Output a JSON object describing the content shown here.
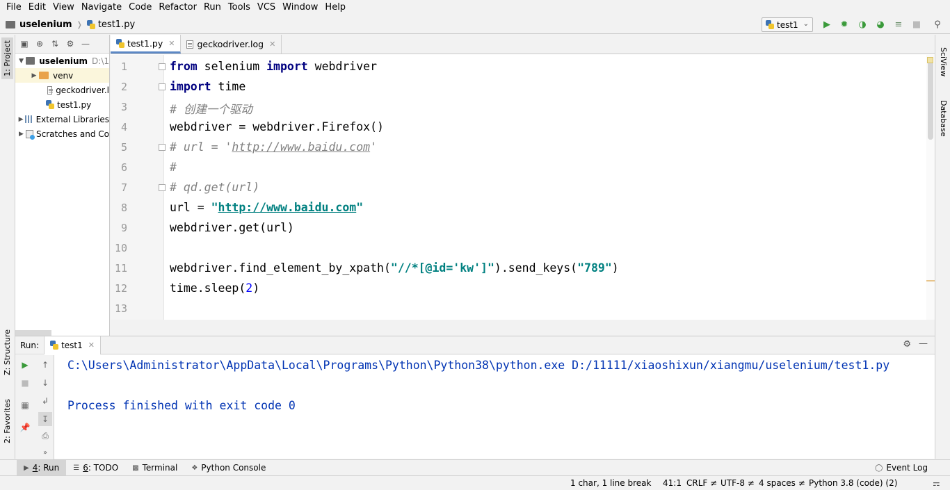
{
  "menu": [
    "File",
    "Edit",
    "View",
    "Navigate",
    "Code",
    "Refactor",
    "Run",
    "Tools",
    "VCS",
    "Window",
    "Help"
  ],
  "breadcrumb": {
    "project": "uselenium",
    "file": "test1.py"
  },
  "run_config": {
    "name": "test1"
  },
  "left_tabs": {
    "project": "1: Project",
    "structure": "Z: Structure",
    "favorites": "2: Favorites"
  },
  "right_tabs": {
    "sciview": "SciView",
    "database": "Database"
  },
  "project_tree": {
    "root": "uselenium",
    "root_path": "D:\\1",
    "items": [
      "venv",
      "geckodriver.l",
      "test1.py"
    ],
    "external": "External Libraries",
    "scratches": "Scratches and Co"
  },
  "editor_tabs": [
    {
      "label": "test1.py"
    },
    {
      "label": "geckodriver.log"
    }
  ],
  "line_numbers": [
    "1",
    "2",
    "3",
    "4",
    "5",
    "6",
    "7",
    "8",
    "9",
    "10",
    "11",
    "12",
    "13"
  ],
  "code": {
    "l1": {
      "kw1": "from",
      "t1": " selenium ",
      "kw2": "import",
      "t2": " webdriver"
    },
    "l2": {
      "kw": "import",
      "t": " time"
    },
    "l3": "# 创建一个驱动",
    "l4": "webdriver = webdriver.Firefox()",
    "l5": {
      "c1": "# url = '",
      "link": "http://www.baidu.com",
      "c2": "'"
    },
    "l6": "#",
    "l7": "# qd.get(url)",
    "l8": {
      "t": "url = ",
      "q1": "\"",
      "link": "http://www.baidu.com",
      "q2": "\""
    },
    "l9": "webdriver.get(url)",
    "l11": {
      "t1": "webdriver.find_element_by_xpath(",
      "s1": "\"//*[@id='kw']\"",
      "t2": ").send_keys(",
      "s2": "\"789\"",
      "t3": ")"
    },
    "l12": {
      "t1": "time.sleep(",
      "n": "2",
      "t2": ")"
    }
  },
  "run": {
    "label": "Run:",
    "tab": "test1",
    "output": [
      "C:\\Users\\Administrator\\AppData\\Local\\Programs\\Python\\Python38\\python.exe D:/11111/xiaoshixun/xiangmu/uselenium/test1.py",
      "Process finished with exit code 0"
    ]
  },
  "bottom_tabs": [
    {
      "key": "4",
      "label": ": Run"
    },
    {
      "key": "6",
      "label": ": TODO"
    },
    {
      "key": "",
      "label": "Terminal"
    },
    {
      "key": "",
      "label": "Python Console"
    }
  ],
  "event_log": "Event Log",
  "status": {
    "selection": "1 char, 1 line break",
    "position": "41:1",
    "line_sep": "CRLF ≠",
    "encoding": "UTF-8 ≠",
    "indent": "4 spaces ≠",
    "interpreter": "Python 3.8 (code) (2)"
  },
  "colors": {
    "keyword": "#000080",
    "string": "#008080",
    "comment": "#808080",
    "console": "#0033b3",
    "run_green": "#3a9a3a"
  }
}
